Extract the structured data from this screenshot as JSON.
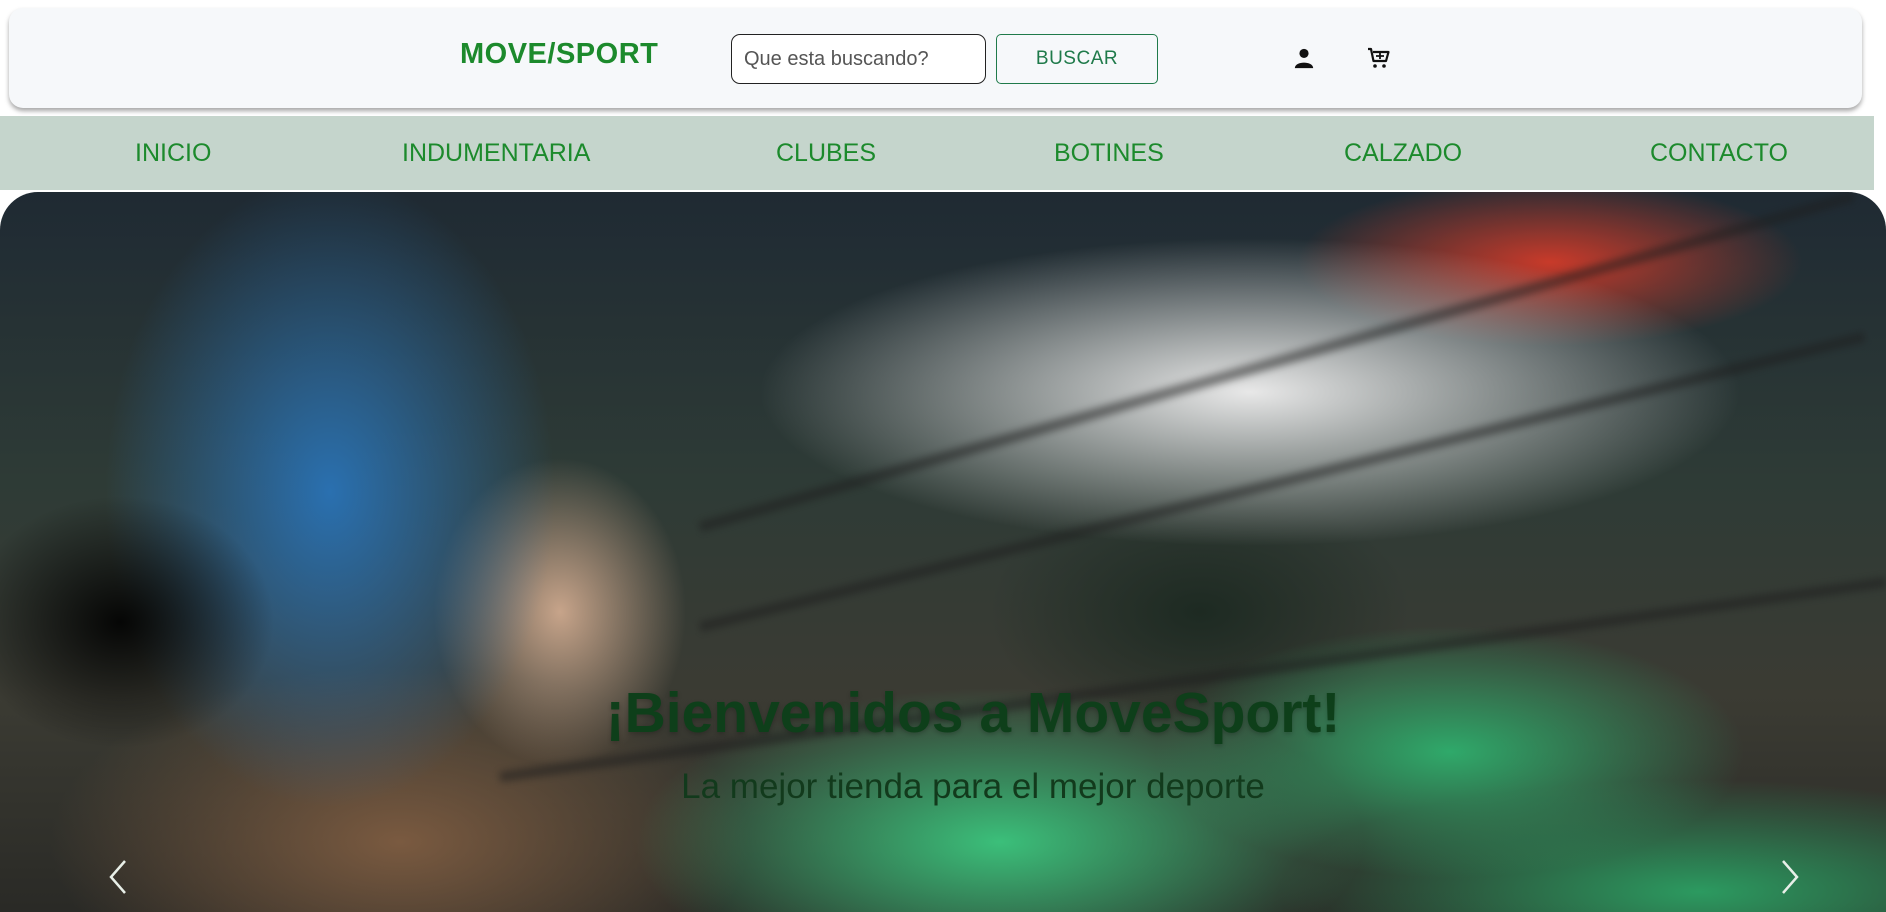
{
  "header": {
    "logo": "MOVE/SPORT",
    "search": {
      "placeholder": "Que esta buscando?",
      "value": "",
      "button_label": "BUSCAR"
    },
    "icons": {
      "user": "user-icon",
      "cart": "cart-icon"
    }
  },
  "nav": {
    "items": [
      {
        "label": "INICIO"
      },
      {
        "label": "INDUMENTARIA"
      },
      {
        "label": "CLUBES"
      },
      {
        "label": "BOTINES"
      },
      {
        "label": "CALZADO"
      },
      {
        "label": "CONTACTO"
      }
    ]
  },
  "hero": {
    "title": "¡Bienvenidos a MoveSport!",
    "subtitle": "La mejor tienda para el mejor deporte",
    "controls": {
      "prev": "chevron-left-icon",
      "next": "chevron-right-icon"
    }
  },
  "colors": {
    "brand_green": "#1c8a2c",
    "nav_background": "#c5d5cc",
    "header_background": "#f6f8fa",
    "hero_title": "#0e3f1a",
    "button_border": "#1f7a4a"
  }
}
